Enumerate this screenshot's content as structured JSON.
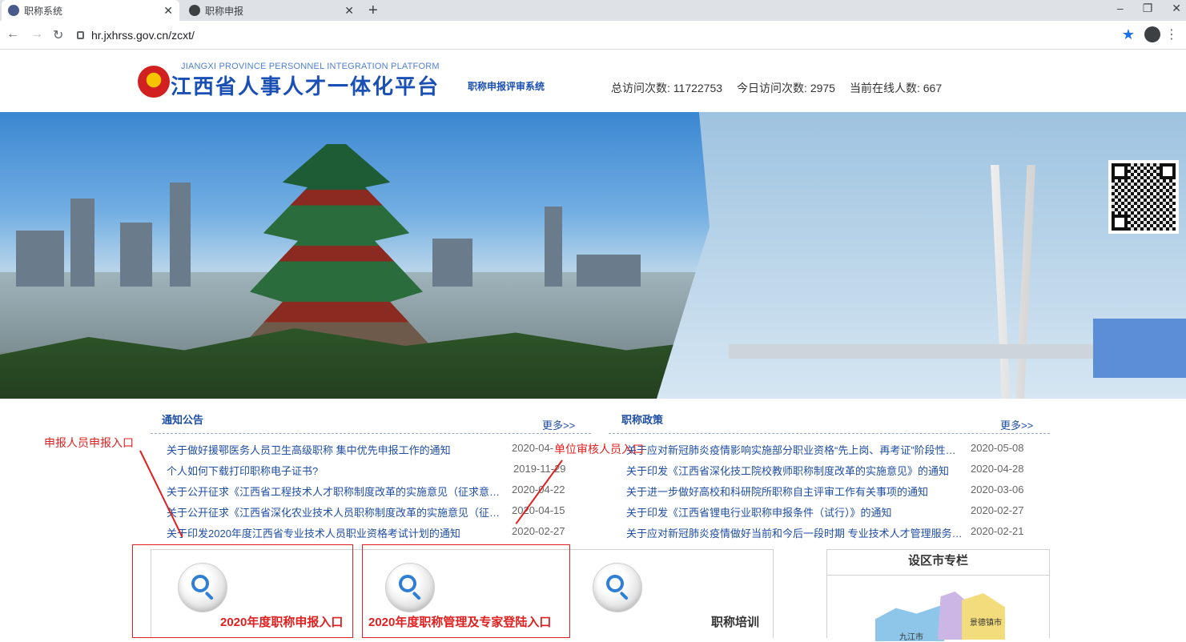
{
  "browser": {
    "tabs": [
      {
        "title": "职称系统",
        "active": true
      },
      {
        "title": "职称申报",
        "active": false
      }
    ],
    "url": "hr.jxhrss.gov.cn/zcxt/"
  },
  "header": {
    "logo_en": "JIANGXI PROVINCE PERSONNEL INTEGRATION PLATFORM",
    "logo_cn": "江西省人事人才一体化平台",
    "logo_sub": "职称申报评审系统",
    "stats": {
      "total_label": "总访问次数:",
      "total_value": "11722753",
      "today_label": "今日访问次数:",
      "today_value": "2975",
      "online_label": "当前在线人数:",
      "online_value": "667"
    }
  },
  "notices": {
    "title": "通知公告",
    "more": "更多>>",
    "items": [
      {
        "text": "关于做好援鄂医务人员卫生高级职称 集中优先申报工作的通知",
        "date": "2020-04-"
      },
      {
        "text": "个人如何下载打印职称电子证书?",
        "date": "2019-11-29"
      },
      {
        "text": "关于公开征求《江西省工程技术人才职称制度改革的实施意见（征求意…",
        "date": "2020-04-22"
      },
      {
        "text": "关于公开征求《江西省深化农业技术人员职称制度改革的实施意见（征…",
        "date": "2020-04-15"
      },
      {
        "text": "关于印发2020年度江西省专业技术人员职业资格考试计划的通知",
        "date": "2020-02-27"
      }
    ]
  },
  "policy": {
    "title": "职称政策",
    "more": "更多>>",
    "items": [
      {
        "text": "关于应对新冠肺炎疫情影响实施部分职业资格“先上岗、再考证”阶段性…",
        "date": "2020-05-08"
      },
      {
        "text": "关于印发《江西省深化技工院校教师职称制度改革的实施意见》的通知",
        "date": "2020-04-28"
      },
      {
        "text": "关于进一步做好高校和科研院所职称自主评审工作有关事项的通知",
        "date": "2020-03-06"
      },
      {
        "text": "关于印发《江西省锂电行业职称申报条件（试行）》的通知",
        "date": "2020-02-27"
      },
      {
        "text": "关于应对新冠肺炎疫情做好当前和今后一段时期 专业技术人才管理服务…",
        "date": "2020-02-21"
      }
    ]
  },
  "annotations": {
    "applicant": "申报人员申报入口",
    "unit": "单位审核人员入口"
  },
  "entries": [
    {
      "label": "2020年度职称申报入口",
      "icon": "search-icon"
    },
    {
      "label": "2020年度职称管理及专家登陆入口",
      "icon": "search-icon"
    },
    {
      "label": "职称培训",
      "icon": "search-icon"
    }
  ],
  "city": {
    "title": "设区市专栏",
    "map_labels": [
      "九江市",
      "景德镇市"
    ]
  },
  "colors": {
    "link_blue": "#1f4ea5",
    "annotation_red": "#e02020"
  }
}
